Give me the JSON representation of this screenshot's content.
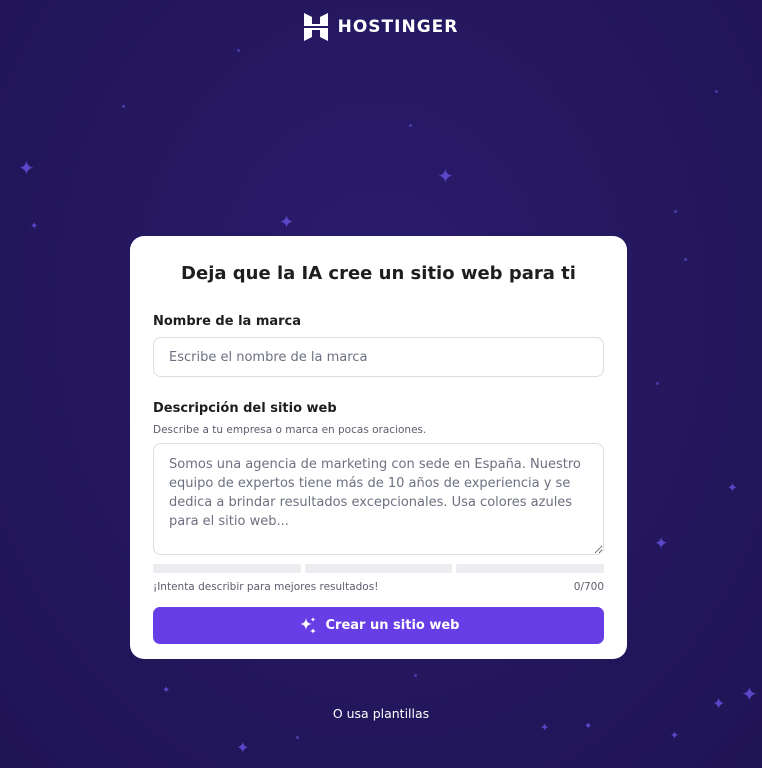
{
  "brand": {
    "name": "HOSTINGER",
    "icon": "hostinger-logo-icon"
  },
  "card": {
    "title": "Deja que la IA cree un sitio web para ti",
    "brand_name": {
      "label": "Nombre de la marca",
      "placeholder": "Escribe el nombre de la marca",
      "value": ""
    },
    "description": {
      "label": "Descripción del sitio web",
      "hint": "Describe a tu empresa o marca en pocas oraciones.",
      "placeholder": "Somos una agencia de marketing con sede en España. Nuestro equipo de expertos tiene más de 10 años de experiencia y se dedica a brindar resultados excepcionales. Usa colores azules para el sitio web...",
      "value": ""
    },
    "strength_hint": "¡Intenta describir para mejores resultados!",
    "char_count": "0/700",
    "create_button": {
      "label": "Crear un sitio web",
      "icon": "sparkles-icon"
    }
  },
  "templates_link": "O usa plantillas",
  "colors": {
    "background": "#24175e",
    "accent": "#673de6",
    "card": "#ffffff",
    "star": "#5a46c8"
  }
}
